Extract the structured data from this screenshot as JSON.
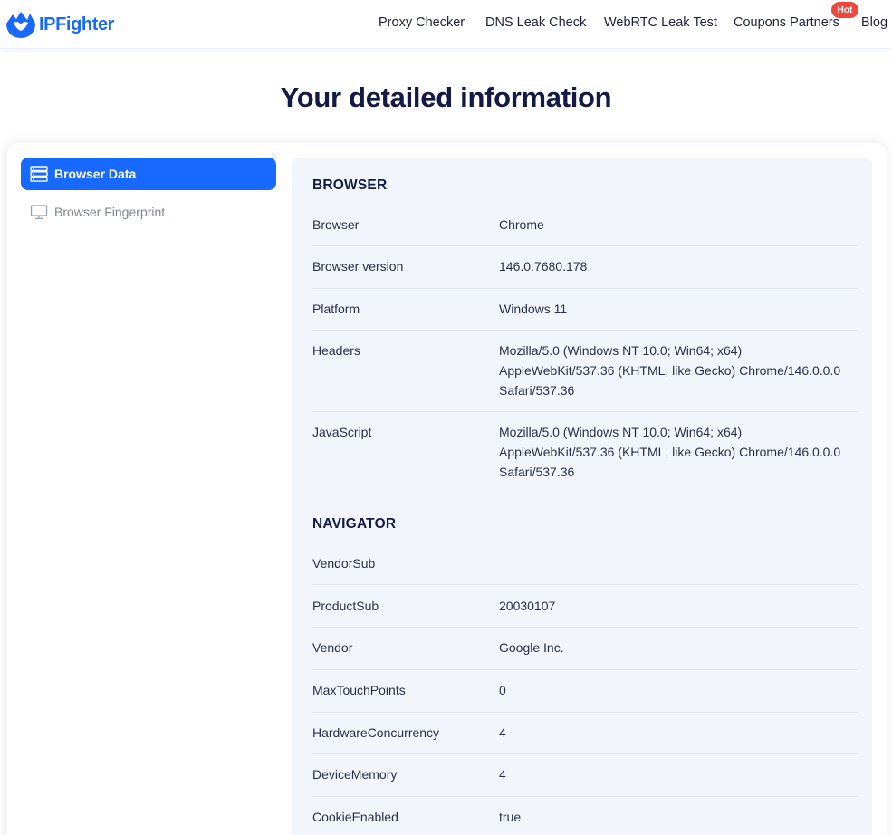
{
  "brand": {
    "name": "IPFighter",
    "accent": "#1769ff"
  },
  "nav": {
    "items": [
      "Proxy Checker",
      "DNS Leak Check",
      "WebRTC Leak Test",
      "Coupons Partners",
      "Blog"
    ],
    "hot_badge": "Hot"
  },
  "page": {
    "title": "Your detailed information"
  },
  "sidebar": {
    "items": [
      {
        "label": "Browser Data",
        "icon": "server-list-icon",
        "active": true
      },
      {
        "label": "Browser Fingerprint",
        "icon": "monitor-icon",
        "active": false
      }
    ]
  },
  "browser": {
    "title": "BROWSER",
    "rows": [
      {
        "label": "Browser",
        "value": "Chrome"
      },
      {
        "label": "Browser version",
        "value": "146.0.7680.178"
      },
      {
        "label": "Platform",
        "value": "Windows 11"
      },
      {
        "label": "Headers",
        "value": "Mozilla/5.0 (Windows NT 10.0; Win64; x64) AppleWebKit/537.36 (KHTML, like Gecko) Chrome/146.0.0.0 Safari/537.36"
      },
      {
        "label": "JavaScript",
        "value": "Mozilla/5.0 (Windows NT 10.0; Win64; x64) AppleWebKit/537.36 (KHTML, like Gecko) Chrome/146.0.0.0 Safari/537.36"
      }
    ]
  },
  "navigator": {
    "title": "NAVIGATOR",
    "rows": [
      {
        "label": "VendorSub",
        "value": ""
      },
      {
        "label": "ProductSub",
        "value": "20030107"
      },
      {
        "label": "Vendor",
        "value": "Google Inc."
      },
      {
        "label": "MaxTouchPoints",
        "value": "0"
      },
      {
        "label": "HardwareConcurrency",
        "value": "4"
      },
      {
        "label": "DeviceMemory",
        "value": "4"
      },
      {
        "label": "CookieEnabled",
        "value": "true"
      }
    ]
  }
}
